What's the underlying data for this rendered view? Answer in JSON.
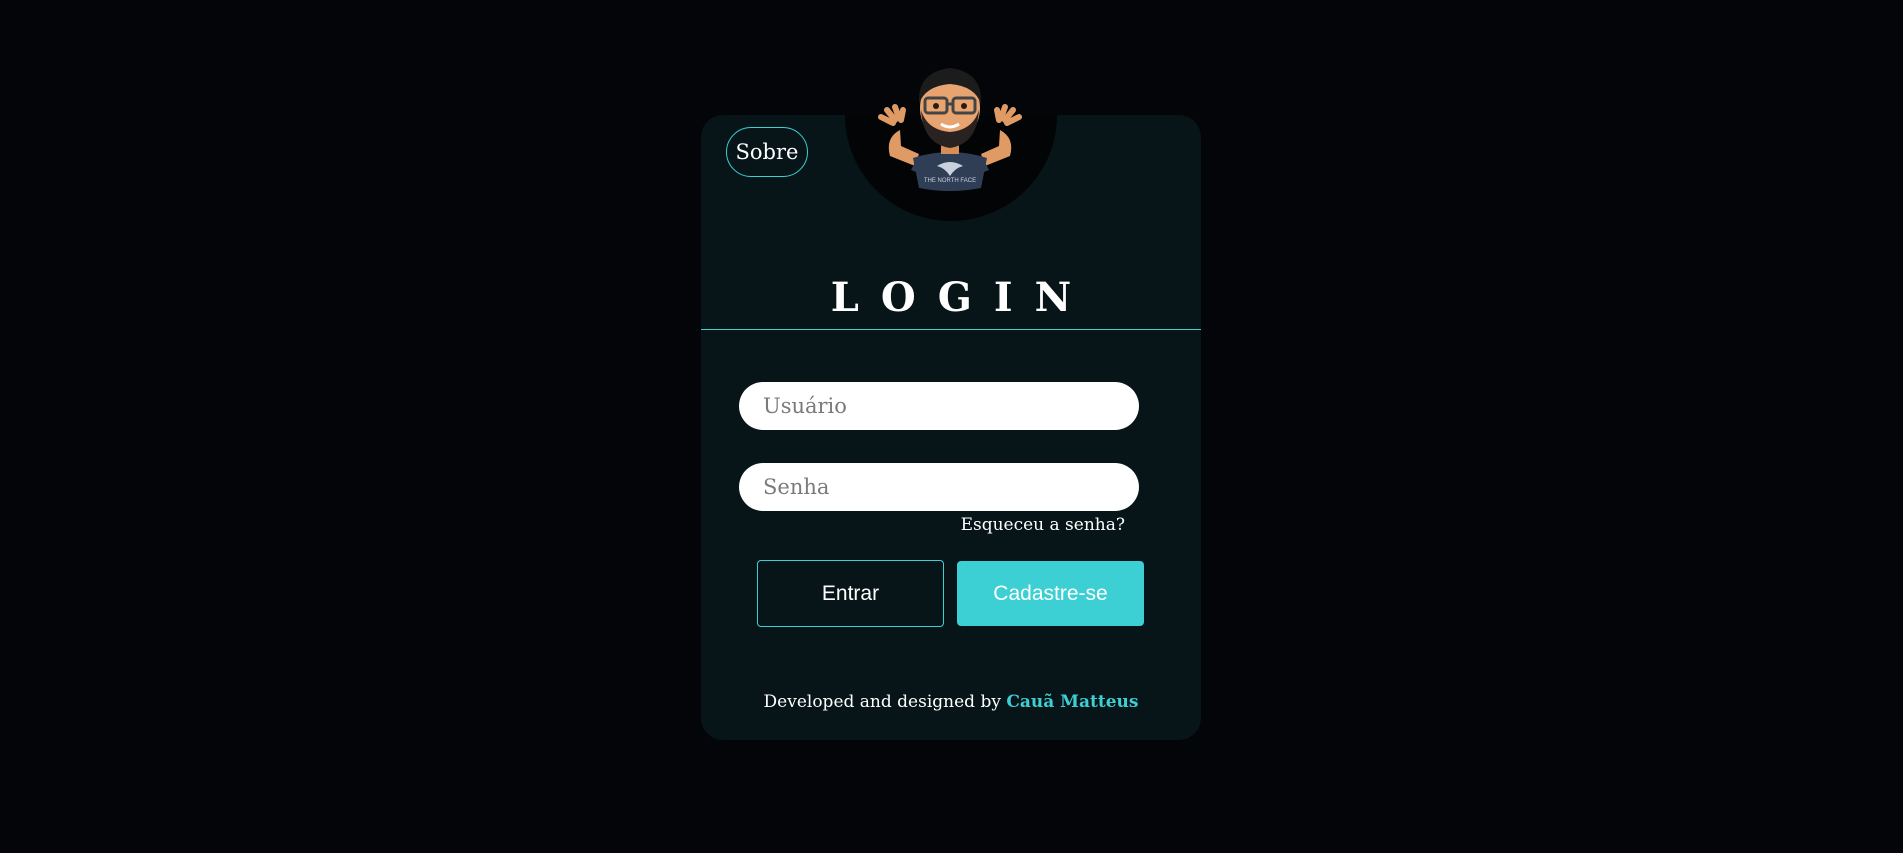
{
  "header": {
    "about_label": "Sobre"
  },
  "login": {
    "title": "LOGIN",
    "username_placeholder": "Usuário",
    "username_value": "",
    "password_placeholder": "Senha",
    "password_value": "",
    "forgot_label": "Esqueceu a senha?",
    "enter_label": "Entrar",
    "signup_label": "Cadastre-se"
  },
  "footer": {
    "prefix": "Developed and designed by",
    "author": "Cauã Matteus"
  },
  "icons": {
    "avatar": "bitmoji-avatar-shrug"
  },
  "colors": {
    "background": "#030508",
    "card": "#071519",
    "accent": "#3ccfd3",
    "text": "#ffffff",
    "input_bg": "#ffffff"
  }
}
